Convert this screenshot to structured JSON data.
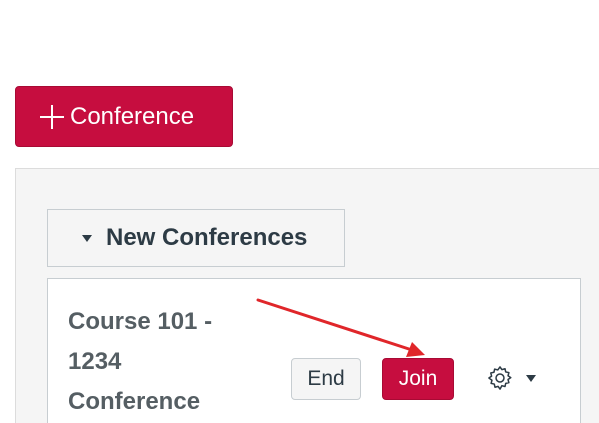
{
  "toolbar": {
    "add_conference_label": "Conference"
  },
  "new_conferences": {
    "section_label": "New Conferences",
    "conference": {
      "title_lines": [
        "Course 101 -",
        "1234",
        "Conference"
      ],
      "end_label": "End",
      "join_label": "Join"
    }
  },
  "icons": {
    "add": "plus-icon",
    "section_toggle": "caret-down-icon",
    "settings": "gear-icon",
    "settings_menu": "caret-down-icon",
    "annotation": "red-arrow"
  },
  "colors": {
    "primary": "#c60d3f",
    "panel_bg": "#f5f5f5",
    "text_dark": "#2d3b45",
    "annotation": "#e0262a"
  }
}
